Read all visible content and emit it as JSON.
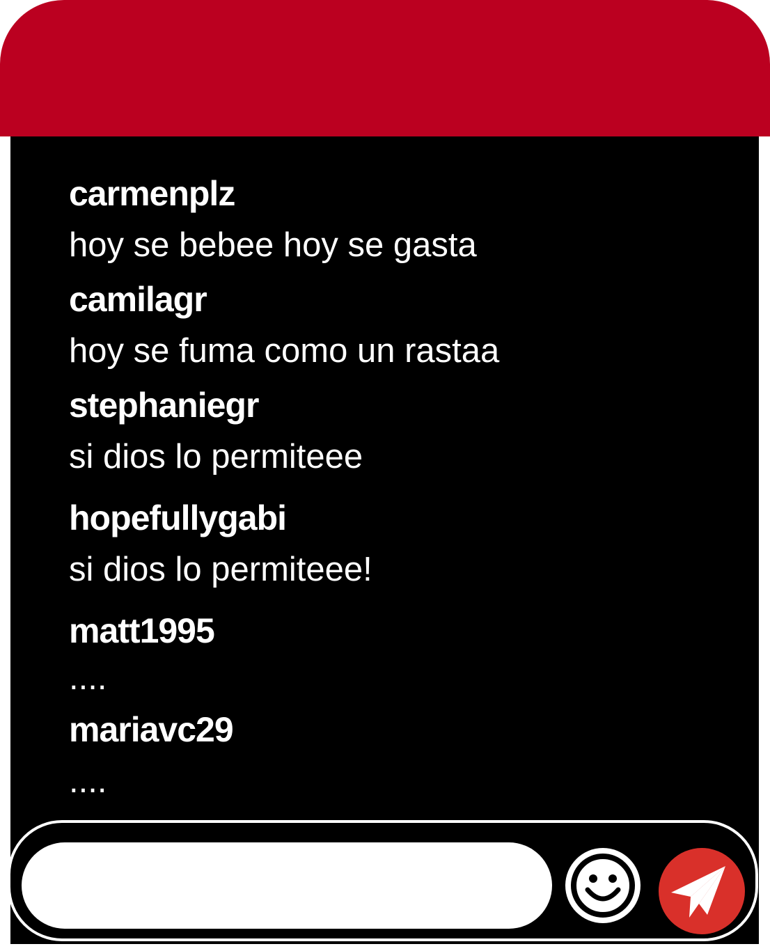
{
  "header": {
    "color": "#bb0020"
  },
  "chat": {
    "messages": [
      {
        "username": "carmenplz",
        "text": "hoy se bebee hoy se gasta"
      },
      {
        "username": "camilagr",
        "text": "hoy se fuma como un rastaa"
      },
      {
        "username": "stephaniegr",
        "text": "si dios lo permiteee"
      },
      {
        "username": "hopefullygabi",
        "text": "si dios lo permiteee!"
      },
      {
        "username": "matt1995",
        "text": "...."
      },
      {
        "username": "mariavc29",
        "text": "...."
      }
    ]
  },
  "input_bar": {
    "value": "",
    "placeholder": "",
    "emoji_icon": "smiley-face-icon",
    "send_icon": "paper-plane-icon",
    "send_color": "#d9302a"
  }
}
